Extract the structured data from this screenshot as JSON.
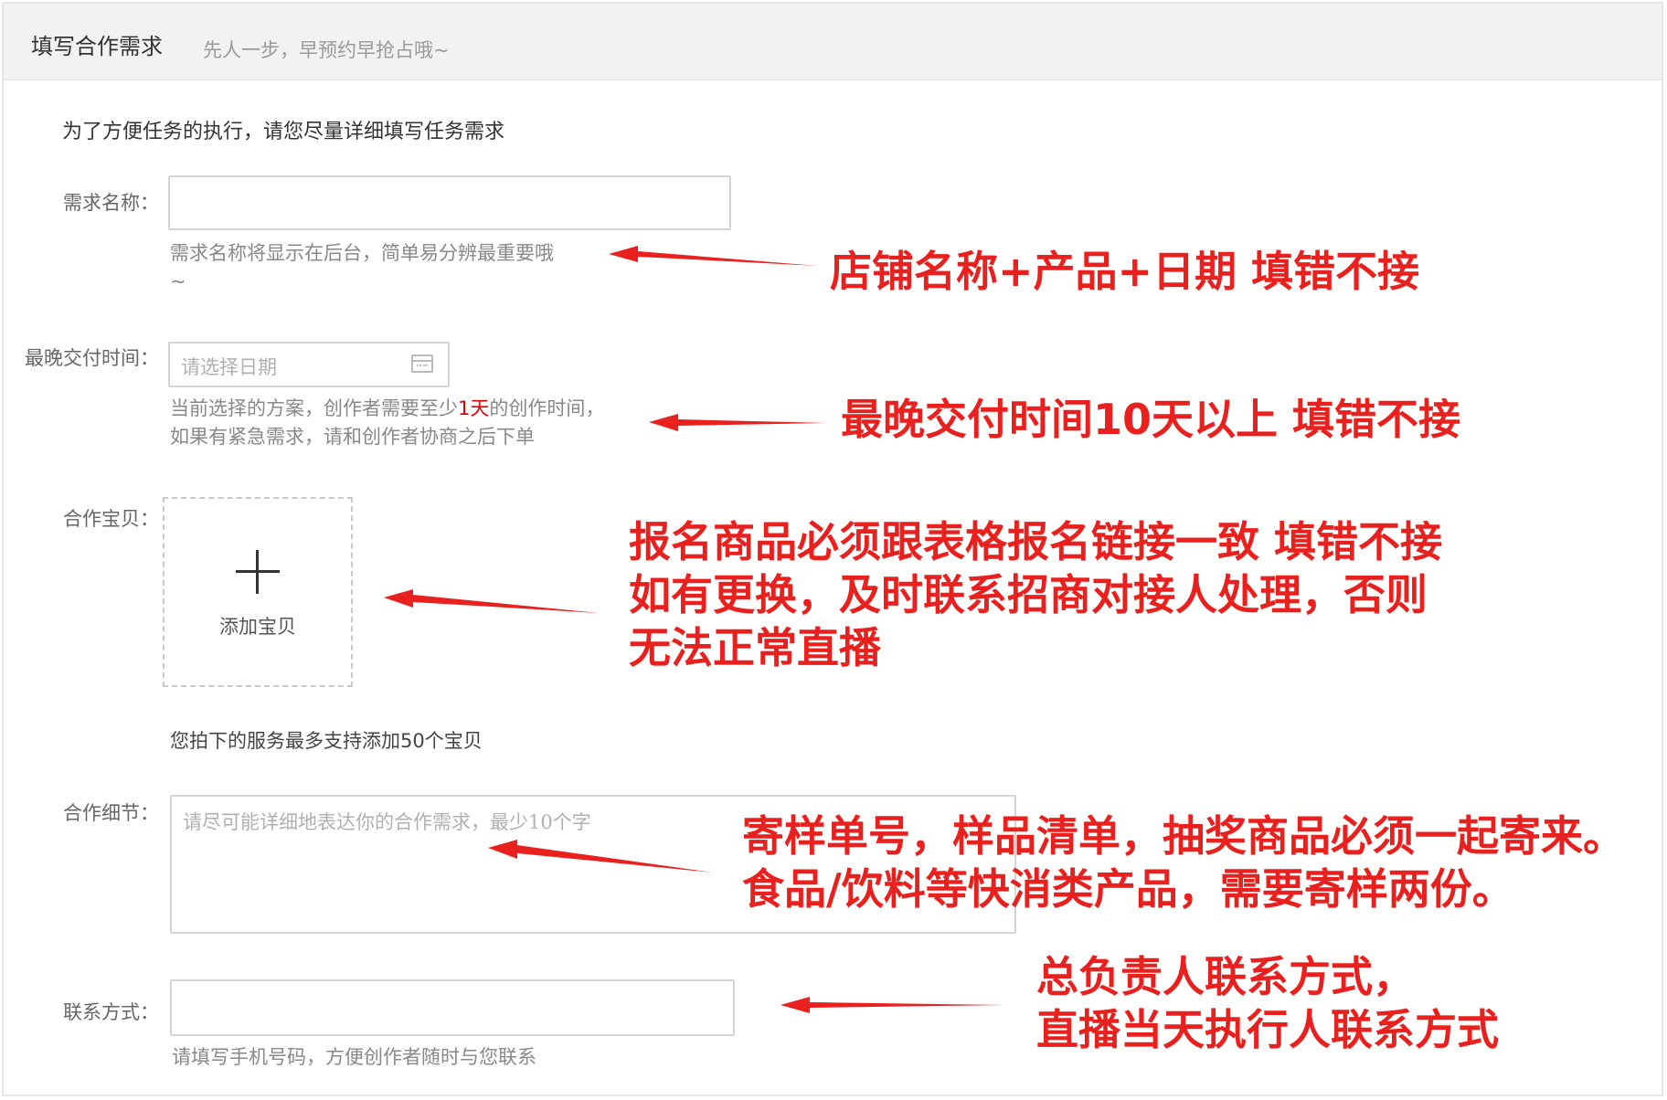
{
  "header": {
    "title": "填写合作需求",
    "subtitle": "先人一步，早预约早抢占哦~"
  },
  "intro": "为了方便任务的执行，请您尽量详细填写任务需求",
  "fields": {
    "name": {
      "label": "需求名称：",
      "hint_line1": "需求名称将显示在后台，简单易分辨最重要哦",
      "hint_line2": "~"
    },
    "deadline": {
      "label": "最晚交付时间：",
      "placeholder": "请选择日期",
      "hint_pre": "当前选择的方案，创作者需要至少",
      "hint_red": "1天",
      "hint_post": "的创作时间，",
      "hint_line2": "如果有紧急需求，请和创作者协商之后下单"
    },
    "items": {
      "label": "合作宝贝：",
      "add_label": "添加宝贝",
      "hint": "您拍下的服务最多支持添加50个宝贝"
    },
    "details": {
      "label": "合作细节：",
      "placeholder": "请尽可能详细地表达你的合作需求，最少10个字"
    },
    "contact": {
      "label": "联系方式：",
      "hint": "请填写手机号码，方便创作者随时与您联系"
    }
  },
  "annotations": {
    "name_note": "店铺名称+产品+日期   填错不接",
    "deadline_note": "最晚交付时间10天以上   填错不接",
    "items_note_line1": "报名商品必须跟表格报名链接一致   填错不接",
    "items_note_line2": "如有更换，及时联系招商对接人处理，否则",
    "items_note_line3": "无法正常直播",
    "details_note_line1": "寄样单号，样品清单，抽奖商品必须一起寄来。",
    "details_note_line2": "食品/饮料等快消类产品，需要寄样两份。",
    "contact_note_line1": "总负责人联系方式，",
    "contact_note_line2": "直播当天执行人联系方式"
  },
  "colors": {
    "annotation_red": "#e8201e",
    "header_bg": "#f2f2f2"
  }
}
